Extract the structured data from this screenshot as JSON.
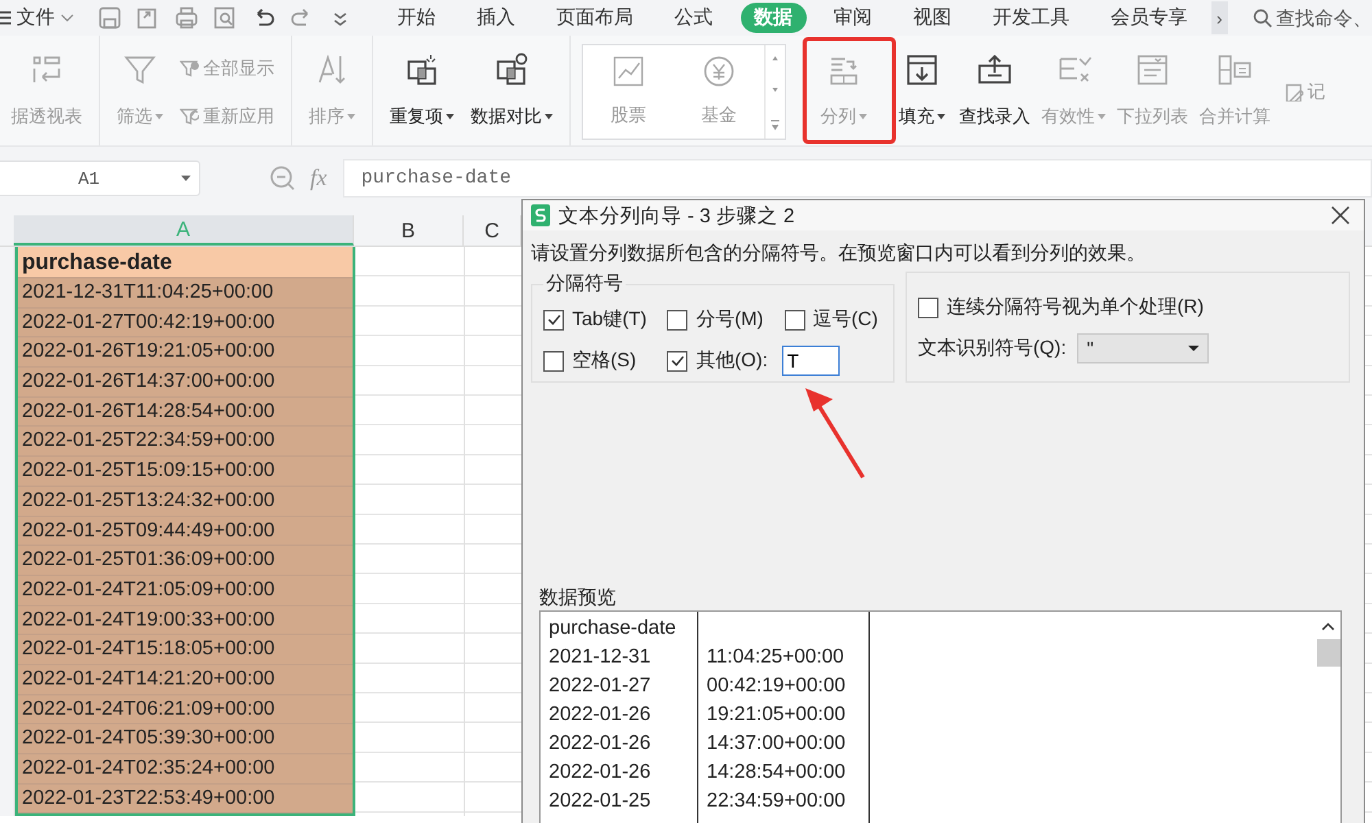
{
  "topbar": {
    "menu_label": "文件",
    "tabs": [
      {
        "label": "开始",
        "selected": false
      },
      {
        "label": "插入",
        "selected": false
      },
      {
        "label": "页面布局",
        "selected": false
      },
      {
        "label": "公式",
        "selected": false
      },
      {
        "label": "数据",
        "selected": true
      },
      {
        "label": "审阅",
        "selected": false
      },
      {
        "label": "视图",
        "selected": false
      },
      {
        "label": "开发工具",
        "selected": false
      },
      {
        "label": "会员专享",
        "selected": false
      }
    ],
    "more": "›",
    "search": {
      "placeholder": "查找命令、"
    }
  },
  "ribbon": {
    "groups": [
      {
        "kind": "plain",
        "items": [
          {
            "label": "据透视表",
            "kind": "large",
            "disabled": true,
            "has_menu": false
          }
        ]
      },
      {
        "kind": "plain",
        "items": [
          {
            "label": "筛选",
            "kind": "large",
            "disabled": true,
            "has_menu": true
          },
          {
            "label": "全部显示",
            "kind": "small",
            "disabled": true,
            "has_menu": false
          },
          {
            "label": "重新应用",
            "kind": "small",
            "disabled": true,
            "has_menu": false
          }
        ]
      },
      {
        "kind": "plain",
        "items": [
          {
            "label": "排序",
            "kind": "large",
            "disabled": true,
            "has_menu": true
          }
        ]
      },
      {
        "kind": "plain",
        "items": [
          {
            "label": "重复项",
            "kind": "large",
            "disabled": false,
            "has_menu": true
          },
          {
            "label": "数据对比",
            "kind": "large",
            "disabled": false,
            "has_menu": true
          }
        ]
      },
      {
        "kind": "gallery",
        "items": [
          {
            "label": "股票",
            "kind": "large",
            "disabled": true,
            "has_menu": false
          },
          {
            "label": "基金",
            "kind": "large",
            "disabled": true,
            "has_menu": false
          }
        ]
      },
      {
        "kind": "plain",
        "items": [
          {
            "label": "分列",
            "kind": "large",
            "disabled": true,
            "has_menu": true
          },
          {
            "label": "填充",
            "kind": "large",
            "disabled": false,
            "has_menu": true
          },
          {
            "label": "查找录入",
            "kind": "large",
            "disabled": false,
            "has_menu": false
          },
          {
            "label": "有效性",
            "kind": "large",
            "disabled": true,
            "has_menu": true
          },
          {
            "label": "下拉列表",
            "kind": "large",
            "disabled": true,
            "has_menu": false
          },
          {
            "label": "合并计算",
            "kind": "large",
            "disabled": true,
            "has_menu": false
          },
          {
            "label": "记",
            "kind": "small",
            "disabled": true,
            "has_menu": false
          }
        ]
      }
    ]
  },
  "formula_bar": {
    "name_box": "A1",
    "fx": "fx",
    "value": "purchase-date"
  },
  "sheet": {
    "columns": [
      {
        "label": "A",
        "selected": true
      },
      {
        "label": "B",
        "selected": false
      },
      {
        "label": "C",
        "selected": false
      }
    ],
    "rows": [
      {
        "kind": "header",
        "text": "purchase-date"
      },
      {
        "kind": "data",
        "text": "2021-12-31T11:04:25+00:00"
      },
      {
        "kind": "data",
        "text": "2022-01-27T00:42:19+00:00"
      },
      {
        "kind": "data",
        "text": "2022-01-26T19:21:05+00:00"
      },
      {
        "kind": "data",
        "text": "2022-01-26T14:37:00+00:00"
      },
      {
        "kind": "data",
        "text": "2022-01-26T14:28:54+00:00"
      },
      {
        "kind": "data",
        "text": "2022-01-25T22:34:59+00:00"
      },
      {
        "kind": "data",
        "text": "2022-01-25T15:09:15+00:00"
      },
      {
        "kind": "data",
        "text": "2022-01-25T13:24:32+00:00"
      },
      {
        "kind": "data",
        "text": "2022-01-25T09:44:49+00:00"
      },
      {
        "kind": "data",
        "text": "2022-01-25T01:36:09+00:00"
      },
      {
        "kind": "data",
        "text": "2022-01-24T21:05:09+00:00"
      },
      {
        "kind": "data",
        "text": "2022-01-24T19:00:33+00:00"
      },
      {
        "kind": "data",
        "text": "2022-01-24T15:18:05+00:00"
      },
      {
        "kind": "data",
        "text": "2022-01-24T14:21:20+00:00"
      },
      {
        "kind": "data",
        "text": "2022-01-24T06:21:09+00:00"
      },
      {
        "kind": "data",
        "text": "2022-01-24T05:39:30+00:00"
      },
      {
        "kind": "data",
        "text": "2022-01-24T02:35:24+00:00"
      },
      {
        "kind": "data",
        "text": "2022-01-23T22:53:49+00:00"
      }
    ]
  },
  "dialog": {
    "title": "文本分列向导 - 3 步骤之 2",
    "instruction": "请设置分列数据所包含的分隔符号。在预览窗口内可以看到分列的效果。",
    "delimiters": {
      "legend": "分隔符号",
      "options": [
        {
          "label": "Tab键(T)",
          "checked": true
        },
        {
          "label": "分号(M)",
          "checked": false
        },
        {
          "label": "逗号(C)",
          "checked": false
        },
        {
          "label": "空格(S)",
          "checked": false
        },
        {
          "label": "其他(O):",
          "checked": true
        }
      ],
      "other_value": "T"
    },
    "consecutive": {
      "label": "连续分隔符号视为单个处理(R)",
      "checked": false
    },
    "qualifier": {
      "label": "文本识别符号(Q):",
      "value": "\""
    },
    "preview": {
      "legend": "数据预览",
      "rows": [
        [
          "purchase-date"
        ],
        [
          "2021-12-31",
          "11:04:25+00:00"
        ],
        [
          "2022-01-27",
          "00:42:19+00:00"
        ],
        [
          "2022-01-26",
          "19:21:05+00:00"
        ],
        [
          "2022-01-26",
          "14:37:00+00:00"
        ],
        [
          "2022-01-26",
          "14:28:54+00:00"
        ],
        [
          "2022-01-25",
          "22:34:59+00:00"
        ]
      ]
    }
  }
}
